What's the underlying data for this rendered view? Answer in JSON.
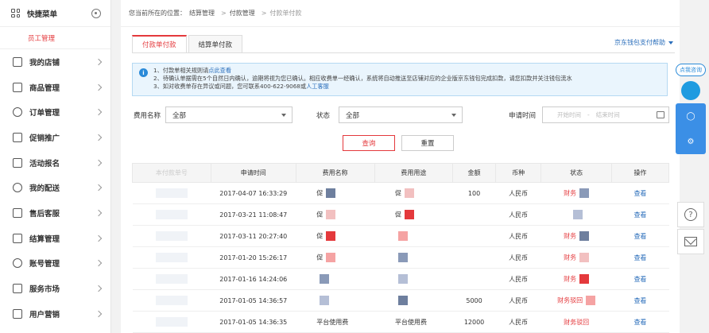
{
  "sidebar": {
    "title": "快捷菜单",
    "sub_item": "员工管理",
    "items": [
      {
        "label": "我的店铺",
        "icon": "store-icon"
      },
      {
        "label": "商品管理",
        "icon": "product-icon"
      },
      {
        "label": "订单管理",
        "icon": "order-icon"
      },
      {
        "label": "促销推广",
        "icon": "promotion-icon"
      },
      {
        "label": "活动报名",
        "icon": "activity-icon"
      },
      {
        "label": "我的配送",
        "icon": "delivery-icon"
      },
      {
        "label": "售后客服",
        "icon": "after-sales-icon"
      },
      {
        "label": "结算管理",
        "icon": "settlement-icon"
      },
      {
        "label": "账号管理",
        "icon": "account-icon"
      },
      {
        "label": "服务市场",
        "icon": "service-market-icon"
      },
      {
        "label": "用户营销",
        "icon": "user-marketing-icon"
      }
    ]
  },
  "breadcrumb": {
    "prefix": "您当前所在的位置：",
    "level1": "结算管理",
    "sep": ">",
    "level2": "付款管理",
    "current": "付款单付款"
  },
  "tabs": [
    {
      "label": "付款单付款",
      "active": true
    },
    {
      "label": "结算单付款",
      "active": false
    }
  ],
  "help_link": "京东钱包支付帮助",
  "notice": {
    "line1_text": "1、付款单相关规则请",
    "line1_link": "点此查看",
    "line2": "2、待确认单据需在5个自然日内确认，逾期将视为您已确认。相应收费单一经确认，系统将自动推送至店铺对应的企业版京东钱包完成扣款，请您扣款并关注钱包流水",
    "line3_text": "3、如对收费单存在异议或问题，您可联系400-622-9068或",
    "line3_link": "人工客服"
  },
  "filters": {
    "fee_name_label": "费用名称",
    "fee_name_value": "全部",
    "status_label": "状态",
    "status_value": "全部",
    "date_label": "申请时间",
    "start_placeholder": "开始时间",
    "date_sep": "-",
    "end_placeholder": "结束时间"
  },
  "buttons": {
    "query": "查询",
    "reset": "重置"
  },
  "table": {
    "headers": [
      "本付款单号",
      "申请时间",
      "费用名称",
      "费用用途",
      "金额",
      "币种",
      "状态",
      "操作"
    ],
    "rows": [
      {
        "time": "2017-04-07 16:33:29",
        "name": "促",
        "use": "促",
        "amount": "100",
        "currency": "人民币",
        "status": "财务",
        "action": "查看"
      },
      {
        "time": "2017-03-21 11:08:47",
        "name": "促",
        "use": "促",
        "amount": "",
        "currency": "人民币",
        "status": "",
        "action": "查看"
      },
      {
        "time": "2017-03-11 20:27:40",
        "name": "促",
        "use": "",
        "amount": "",
        "currency": "人民币",
        "status": "财务",
        "action": "查看"
      },
      {
        "time": "2017-01-20 15:26:17",
        "name": "促",
        "use": "",
        "amount": "",
        "currency": "人民币",
        "status": "财务",
        "action": "查看"
      },
      {
        "time": "2017-01-16 14:24:06",
        "name": "",
        "use": "",
        "amount": "",
        "currency": "人民币",
        "status": "财务",
        "action": "查看"
      },
      {
        "time": "2017-01-05 14:36:57",
        "name": "",
        "use": "",
        "amount": "5000",
        "currency": "人民币",
        "status": "财务驳回",
        "action": "查看"
      },
      {
        "time": "2017-01-05 14:36:35",
        "name": "平台使用费",
        "use": "平台使用费",
        "amount": "12000",
        "currency": "人民币",
        "status": "财务驳回",
        "action": "查看"
      }
    ]
  },
  "float": {
    "bubble": "点我咨询"
  },
  "colors": {
    "accent_red": "#e4393c",
    "link_blue": "#2a6ebb",
    "notice_bg": "#eaf5fd"
  }
}
